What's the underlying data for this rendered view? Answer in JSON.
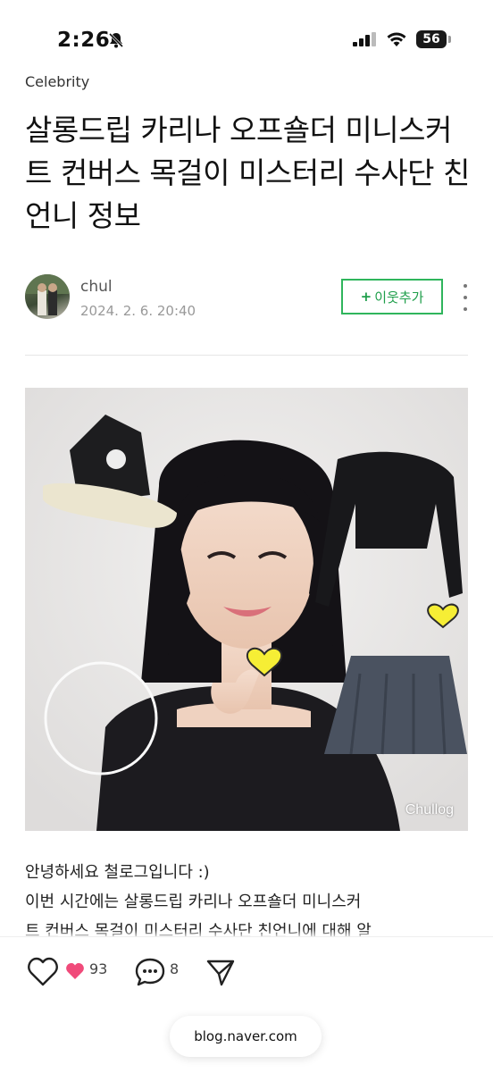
{
  "status_bar": {
    "time": "2:26",
    "battery": "56"
  },
  "post": {
    "category": "Celebrity",
    "title": "살롱드립 카리나 오프숄더 미니스커트 컨버스 목걸이 미스터리 수사단 친언니 정보",
    "author": "chul",
    "date": "2024. 2. 6. 20:40",
    "follow_label": "이웃추가",
    "follow_plus": "+",
    "image_watermark": "Chullog",
    "body_line1": "안녕하세요 철로그입니다 :)",
    "body_line2": "이번 시간에는 살롱드립 카리나 오프숄더 미니스커",
    "body_line3": "트 컨버스 목걸이 미스터리 수사단 친언니에 대해 알"
  },
  "actions": {
    "like_count": "93",
    "comment_count": "8",
    "accent": "#2fb55c",
    "heart_color": "#f04a7a"
  },
  "browser": {
    "url": "blog.naver.com"
  }
}
